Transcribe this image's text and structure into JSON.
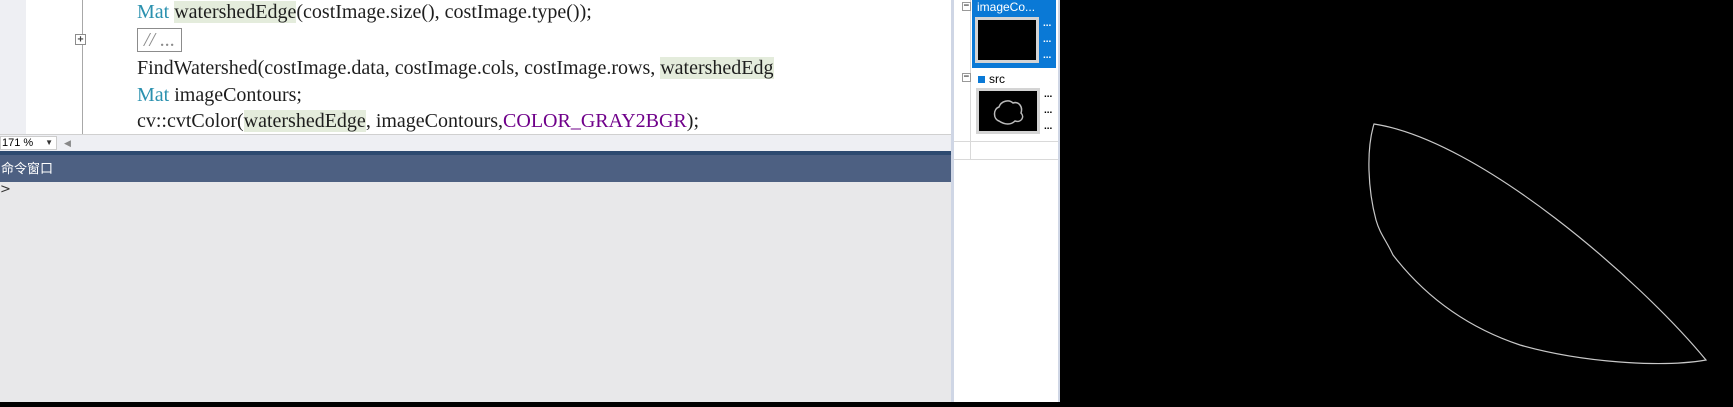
{
  "editor": {
    "lines": {
      "l1": {
        "kw": "Mat",
        "hl": "watershedEdge",
        "rest": "(costImage.size(), costImage.type());"
      },
      "l2": {
        "collapsed": "// ..."
      },
      "l3": {
        "text": "FindWatershed(costImage.data, costImage.cols, costImage.rows, ",
        "hl": "watershedEdg"
      },
      "l4": {
        "kw": "Mat",
        "rest": " imageContours;"
      },
      "l5": {
        "pre": "cv::cvtColor(",
        "hl": "watershedEdge",
        "mid": ", imageContours,",
        "const": "COLOR_GRAY2BGR",
        "post": ");"
      }
    },
    "zoom": "171 %"
  },
  "command_window": {
    "title": "命令窗口",
    "prompt": ">"
  },
  "image_panel": {
    "items": [
      {
        "name": "imageCo...",
        "dots": [
          "...",
          "...",
          "..."
        ],
        "selected": true
      },
      {
        "name": "src",
        "dots": [
          "...",
          "...",
          "..."
        ],
        "selected": false
      }
    ]
  },
  "colors": {
    "accent": "#0a79d6",
    "cmd_header": "#4d6082",
    "keyword": "#2b91af"
  }
}
